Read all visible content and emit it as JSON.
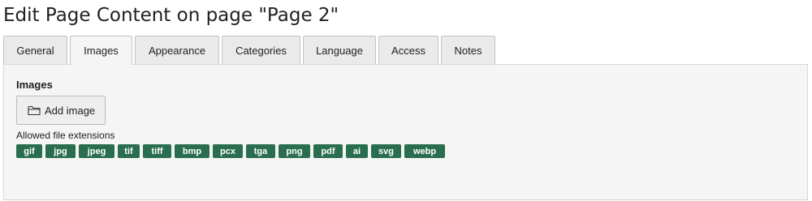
{
  "page": {
    "title": "Edit Page Content on page \"Page 2\""
  },
  "tabs": [
    {
      "label": "General",
      "active": false
    },
    {
      "label": "Images",
      "active": true
    },
    {
      "label": "Appearance",
      "active": false
    },
    {
      "label": "Categories",
      "active": false
    },
    {
      "label": "Language",
      "active": false
    },
    {
      "label": "Access",
      "active": false
    },
    {
      "label": "Notes",
      "active": false
    }
  ],
  "images": {
    "section_title": "Images",
    "add_button_label": "Add image",
    "add_button_icon": "folder-icon",
    "allowed_label": "Allowed file extensions",
    "extensions": [
      "gif",
      "jpg",
      "jpeg",
      "tif",
      "tiff",
      "bmp",
      "pcx",
      "tga",
      "png",
      "pdf",
      "ai",
      "svg",
      "webp"
    ]
  },
  "colors": {
    "badge_background": "#2a6e50",
    "panel_background": "#f5f5f5",
    "tab_background": "#eaeaea"
  }
}
